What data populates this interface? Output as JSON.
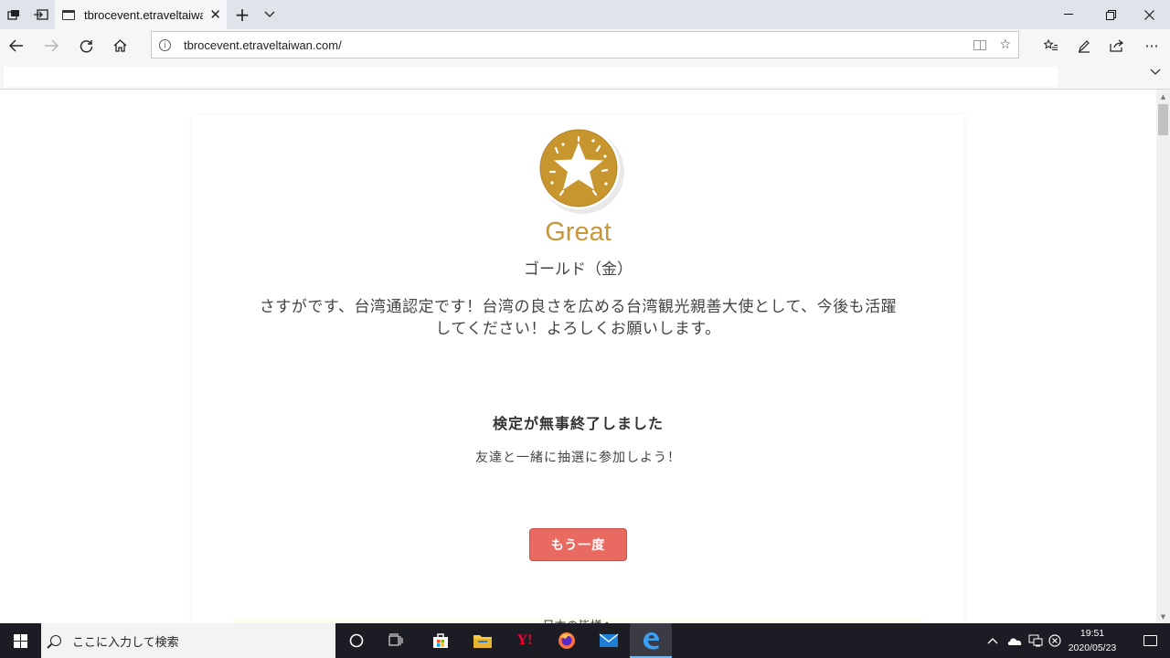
{
  "browser": {
    "tab": {
      "title": "tbrocevent.etraveltaiwan.com"
    },
    "address": {
      "url": "tbrocevent.etraveltaiwan.com/"
    }
  },
  "page": {
    "rank_title": "Great",
    "rank_subtitle": "ゴールド（金）",
    "message_line1": "さすがです、台湾通認定です！台湾の良さを広める台湾観光親善大使として、今後も活躍",
    "message_line2": "してください！よろしくお願いします。",
    "completion_title": "検定が無事終了しました",
    "completion_subtitle": "友達と一緒に抽選に参加しよう！",
    "retry_button": "もう一度",
    "peek_text": "日本の皆様へ",
    "medal_color": "#c6963a",
    "button_color": "#e96a61"
  },
  "taskbar": {
    "search_placeholder": "ここに入力して検索",
    "time": "19:51",
    "date": "2020/05/23"
  }
}
